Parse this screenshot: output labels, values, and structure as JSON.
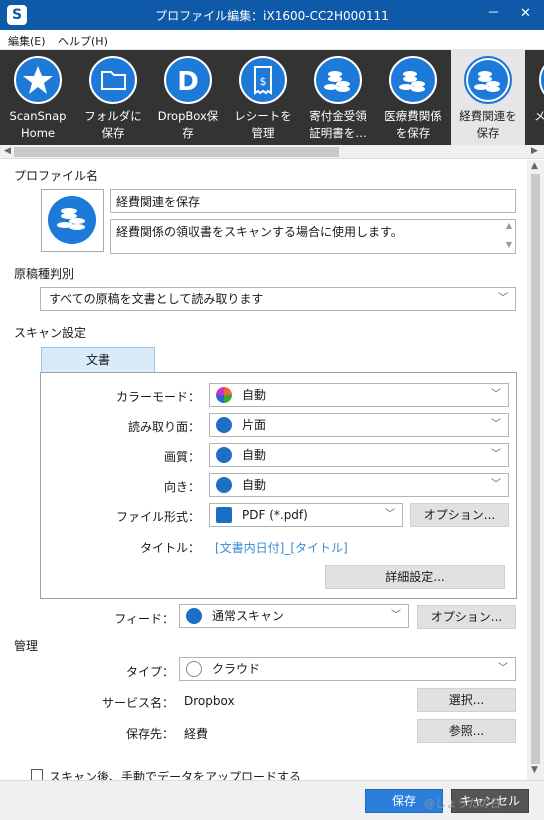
{
  "window": {
    "title": "プロファイル編集：iX1600-CC2H000111",
    "minimize": "－",
    "close": "✕"
  },
  "menu": {
    "edit": "編集(E)",
    "help": "ヘルプ(H)"
  },
  "ribbon": {
    "items": [
      {
        "line1": "ScanSnap",
        "line2": "Home",
        "icon": "star-icon"
      },
      {
        "line1": "フォルダに",
        "line2": "保存",
        "icon": "folder-icon"
      },
      {
        "line1": "DropBox保",
        "line2": "存",
        "icon": "dropbox-icon"
      },
      {
        "line1": "レシートを",
        "line2": "管理",
        "icon": "receipt-icon"
      },
      {
        "line1": "寄付金受領",
        "line2": "証明書を…",
        "icon": "coins-icon"
      },
      {
        "line1": "医療費関係",
        "line2": "を保存",
        "icon": "coins-icon"
      },
      {
        "line1": "経費関連を",
        "line2": "保存",
        "icon": "coins-icon"
      },
      {
        "line1": "メ",
        "line2": "",
        "icon": "partial-icon"
      }
    ]
  },
  "profile": {
    "section": "プロファイル名",
    "name": "経費関連を保存",
    "description": "経費関係の領収書をスキャンする場合に使用します。"
  },
  "doctype": {
    "section": "原稿種判別",
    "value": "すべての原稿を文書として読み取ります"
  },
  "scan": {
    "section": "スキャン設定",
    "tab": "文書",
    "color_label": "カラーモード：",
    "color_value": "自動",
    "side_label": "読み取り面：",
    "side_value": "片面",
    "quality_label": "画質：",
    "quality_value": "自動",
    "orient_label": "向き：",
    "orient_value": "自動",
    "format_label": "ファイル形式：",
    "format_value": "PDF (*.pdf)",
    "format_option": "オプション...",
    "title_label": "タイトル：",
    "title_value": "[文書内日付]_[タイトル]",
    "detail_button": "詳細設定...",
    "feed_label": "フィード：",
    "feed_value": "通常スキャン",
    "feed_option": "オプション..."
  },
  "manage": {
    "section": "管理",
    "type_label": "タイプ：",
    "type_value": "クラウド",
    "service_label": "サービス名：",
    "service_value": "Dropbox",
    "select_button": "選択...",
    "dest_label": "保存先：",
    "dest_value": "経費",
    "browse_button": "参照..."
  },
  "upload": {
    "label": "スキャン後、手動でデータをアップロードする"
  },
  "footer": {
    "save": "保存",
    "cancel": "キャンセル",
    "watermark": "@しょうたの日"
  }
}
